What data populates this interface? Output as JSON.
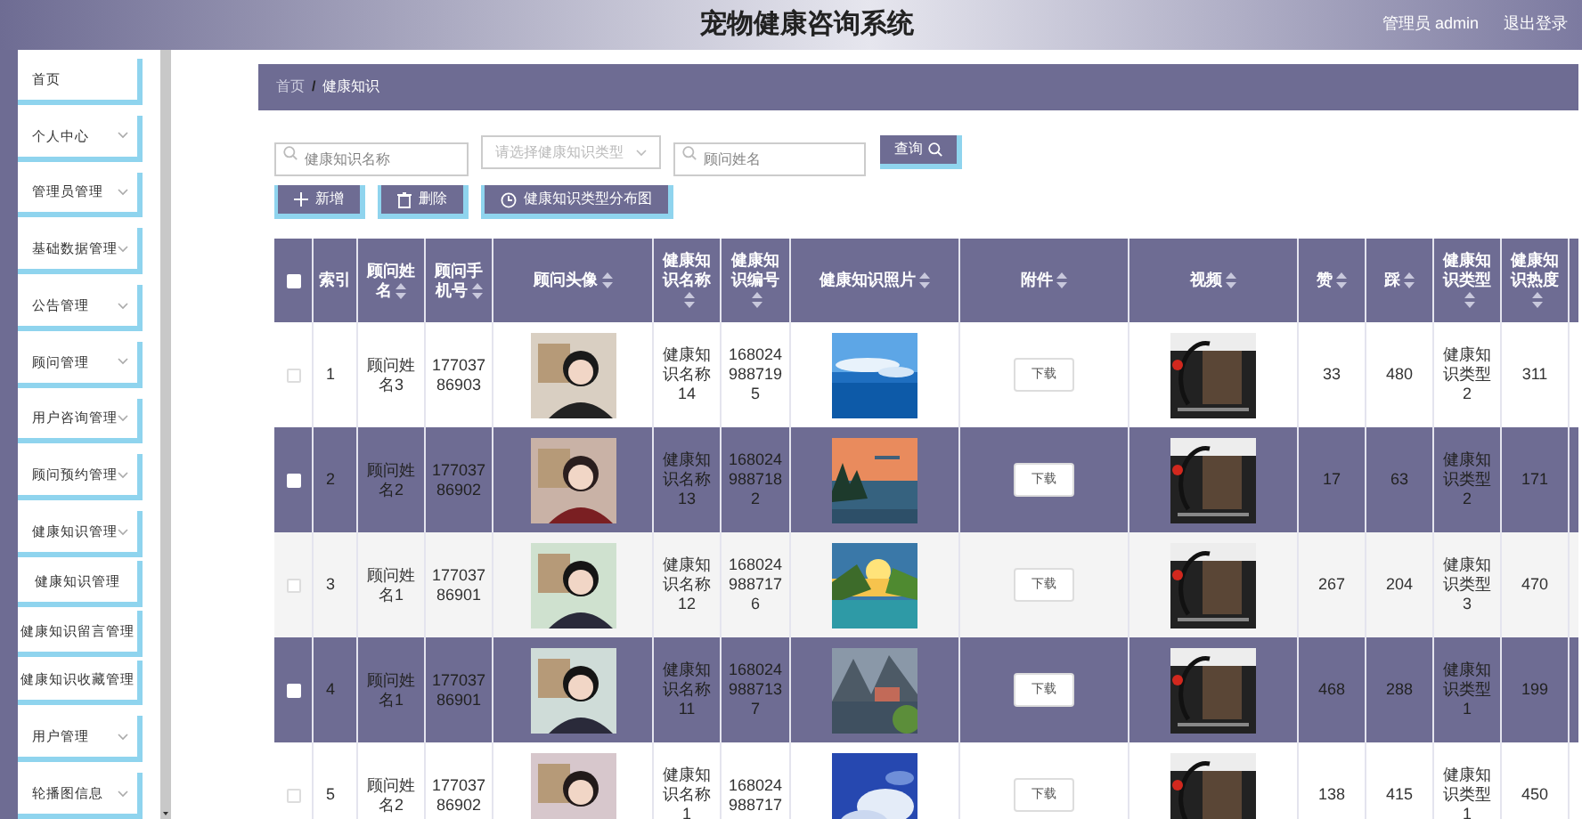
{
  "header": {
    "title": "宠物健康咨询系统",
    "user": "管理员 admin",
    "logout": "退出登录"
  },
  "sidebar": {
    "items": [
      {
        "label": "首页",
        "expandable": false
      },
      {
        "label": "个人中心",
        "expandable": true
      },
      {
        "label": "管理员管理",
        "expandable": true
      },
      {
        "label": "基础数据管理",
        "expandable": true
      },
      {
        "label": "公告管理",
        "expandable": true
      },
      {
        "label": "顾问管理",
        "expandable": true
      },
      {
        "label": "用户咨询管理",
        "expandable": true
      },
      {
        "label": "顾问预约管理",
        "expandable": true
      },
      {
        "label": "健康知识管理",
        "expandable": true,
        "children": [
          {
            "label": "健康知识管理"
          },
          {
            "label": "健康知识留言管理"
          },
          {
            "label": "健康知识收藏管理"
          }
        ]
      },
      {
        "label": "用户管理",
        "expandable": true
      },
      {
        "label": "轮播图信息",
        "expandable": true
      }
    ]
  },
  "breadcrumb": {
    "items": [
      "首页",
      "健康知识"
    ],
    "separator": "/"
  },
  "filters": {
    "name": {
      "placeholder": "健康知识名称"
    },
    "type": {
      "placeholder": "请选择健康知识类型"
    },
    "advisor": {
      "placeholder": "顾问姓名"
    },
    "search_button": "查询"
  },
  "actions": [
    {
      "label": "新增",
      "kind": "add"
    },
    {
      "label": "删除",
      "kind": "delete"
    },
    {
      "label": "健康知识类型分布图",
      "kind": "chart"
    }
  ],
  "table": {
    "columns": [
      {
        "label": "索引",
        "sortable": false
      },
      {
        "label": "顾问姓名",
        "sortable": true
      },
      {
        "label": "顾问手机号",
        "sortable": true
      },
      {
        "label": "顾问头像",
        "sortable": true
      },
      {
        "label": "健康知识名称",
        "sortable": true
      },
      {
        "label": "健康知识编号",
        "sortable": true
      },
      {
        "label": "健康知识照片",
        "sortable": true
      },
      {
        "label": "附件",
        "sortable": true
      },
      {
        "label": "视频",
        "sortable": true
      },
      {
        "label": "赞",
        "sortable": true
      },
      {
        "label": "踩",
        "sortable": true
      },
      {
        "label": "健康知识类型",
        "sortable": true
      },
      {
        "label": "健康知识热度",
        "sortable": true
      }
    ],
    "select_all": {
      "checked": false
    },
    "rows": [
      {
        "checked": false,
        "download": "下载",
        "index": "1",
        "advisor": "顾问姓名3",
        "phone": "17703786903",
        "name": "健康知识名称14",
        "number": "1680249887195",
        "likes": "33",
        "dislikes": "480",
        "type": "健康知识类型2",
        "heat": "311"
      },
      {
        "checked": false,
        "download": "下载",
        "index": "2",
        "advisor": "顾问姓名2",
        "phone": "17703786902",
        "name": "健康知识名称13",
        "number": "1680249887182",
        "likes": "17",
        "dislikes": "63",
        "type": "健康知识类型2",
        "heat": "171"
      },
      {
        "checked": false,
        "download": "下载",
        "index": "3",
        "advisor": "顾问姓名1",
        "phone": "17703786901",
        "name": "健康知识名称12",
        "number": "1680249887176",
        "likes": "267",
        "dislikes": "204",
        "type": "健康知识类型3",
        "heat": "470"
      },
      {
        "checked": false,
        "download": "下载",
        "index": "4",
        "advisor": "顾问姓名1",
        "phone": "17703786901",
        "name": "健康知识名称11",
        "number": "1680249887137",
        "likes": "468",
        "dislikes": "288",
        "type": "健康知识类型1",
        "heat": "199"
      },
      {
        "checked": false,
        "download": "下载",
        "index": "5",
        "advisor": "顾问姓名2",
        "phone": "17703786902",
        "name": "健康知识名称1",
        "number": "168024988717",
        "likes": "138",
        "dislikes": "415",
        "type": "健康知识类型1",
        "heat": "450"
      }
    ]
  }
}
